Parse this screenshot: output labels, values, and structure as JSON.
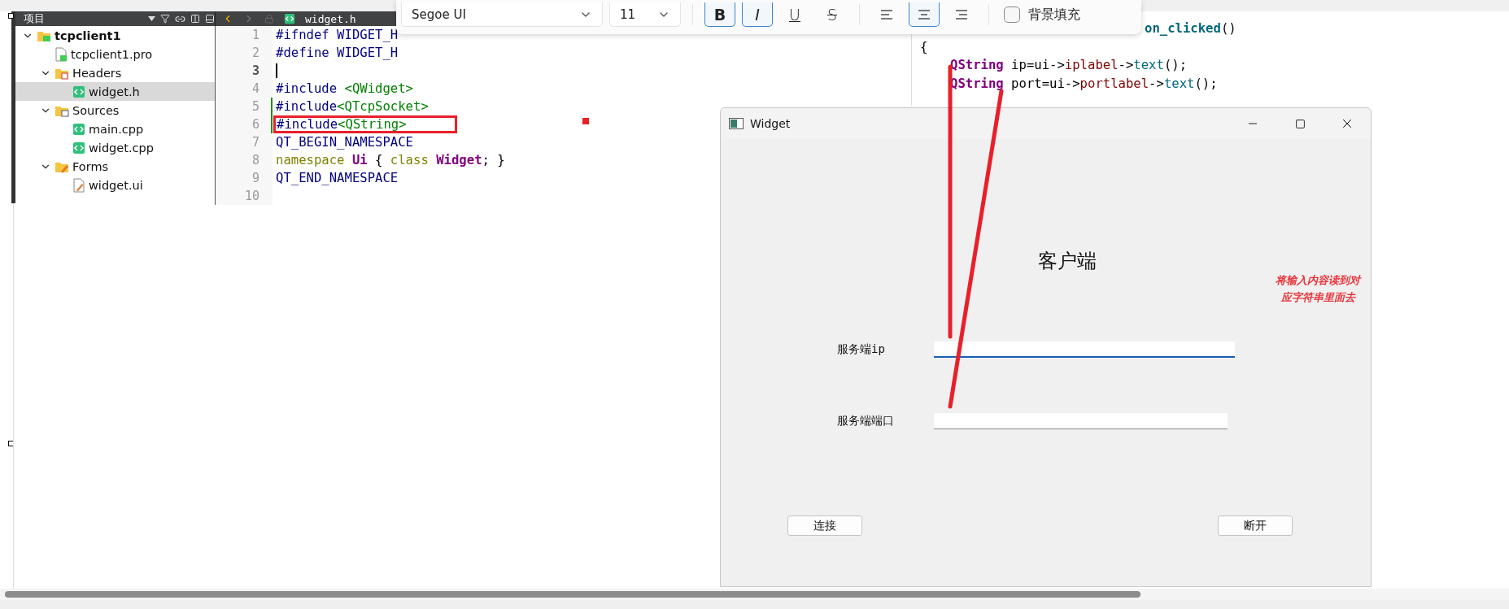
{
  "project_panel": {
    "title": "项目",
    "tree": [
      {
        "label": "tcpclient1",
        "kind": "project",
        "expanded": true,
        "selected": false,
        "children": [
          {
            "label": "tcpclient1.pro",
            "kind": "pro",
            "selected": false
          },
          {
            "label": "Headers",
            "kind": "headers",
            "expanded": true,
            "selected": false,
            "children": [
              {
                "label": "widget.h",
                "kind": "file",
                "selected": true
              }
            ]
          },
          {
            "label": "Sources",
            "kind": "sources",
            "expanded": true,
            "selected": false,
            "children": [
              {
                "label": "main.cpp",
                "kind": "file",
                "selected": false
              },
              {
                "label": "widget.cpp",
                "kind": "file",
                "selected": false
              }
            ]
          },
          {
            "label": "Forms",
            "kind": "forms",
            "expanded": true,
            "selected": false,
            "children": [
              {
                "label": "widget.ui",
                "kind": "ui",
                "selected": false
              }
            ]
          }
        ]
      }
    ]
  },
  "editor": {
    "file_tab": "widget.h",
    "lines": [
      {
        "number": "1",
        "current": false,
        "modified": false,
        "boxed": false,
        "tokens": [
          {
            "text": "#ifndef WIDGET_H",
            "kind": "macro"
          }
        ]
      },
      {
        "number": "2",
        "current": false,
        "modified": false,
        "boxed": false,
        "tokens": [
          {
            "text": "#define WIDGET_H",
            "kind": "macro"
          }
        ]
      },
      {
        "number": "3",
        "current": true,
        "modified": false,
        "boxed": false
      },
      {
        "number": "4",
        "current": false,
        "modified": false,
        "boxed": false,
        "tokens": [
          {
            "text": "#include ",
            "kind": "macro"
          },
          {
            "text": "<QWidget>",
            "kind": "string"
          }
        ]
      },
      {
        "number": "5",
        "current": false,
        "modified": true,
        "boxed": false,
        "tokens": [
          {
            "text": "#include",
            "kind": "macro"
          },
          {
            "text": "<QTcpSocket>",
            "kind": "string"
          }
        ]
      },
      {
        "number": "6",
        "current": false,
        "modified": true,
        "boxed": true,
        "tokens": [
          {
            "text": "#include",
            "kind": "macro"
          },
          {
            "text": "<QString>",
            "kind": "string"
          }
        ]
      },
      {
        "number": "7",
        "current": false,
        "modified": false,
        "boxed": false,
        "tokens": [
          {
            "text": "QT_BEGIN_NAMESPACE",
            "kind": "macro"
          }
        ]
      },
      {
        "number": "8",
        "current": false,
        "modified": false,
        "boxed": false,
        "tokens": [
          {
            "text": "namespace",
            "kind": "keyword"
          },
          {
            "text": " Ui",
            "kind": "type"
          },
          {
            "text": " { ",
            "kind": "plain"
          },
          {
            "text": "class",
            "kind": "keyword"
          },
          {
            "text": " Widget",
            "kind": "type"
          },
          {
            "text": "; }",
            "kind": "plain"
          }
        ]
      },
      {
        "number": "9",
        "current": false,
        "modified": false,
        "boxed": false,
        "tokens": [
          {
            "text": "QT_END_NAMESPACE",
            "kind": "macro"
          }
        ]
      },
      {
        "number": "10",
        "current": false,
        "modified": false,
        "boxed": false
      }
    ]
  },
  "format_toolbar": {
    "font_family": "Segoe UI",
    "font_size": "11",
    "format_buttons": [
      {
        "glyph": "B",
        "kind": "bold",
        "selected": true
      },
      {
        "glyph": "I",
        "kind": "italic",
        "selected": true
      },
      {
        "glyph": "U",
        "kind": "underline",
        "selected": false
      },
      {
        "glyph": "S",
        "kind": "strike",
        "selected": false
      }
    ],
    "align_buttons": [
      {
        "kind": "left",
        "selected": false
      },
      {
        "kind": "center",
        "selected": true
      },
      {
        "kind": "right",
        "selected": false
      }
    ],
    "fill_checkbox": {
      "label": "背景填充",
      "checked": false
    }
  },
  "code_right": {
    "lines": [
      {
        "indent": false,
        "tokens": [
          {
            "text": "on_clicked",
            "kind": "function"
          },
          {
            "text": "()",
            "kind": "plain"
          }
        ]
      },
      {
        "indent": false,
        "tokens": [
          {
            "text": "{",
            "kind": "plain"
          }
        ]
      },
      {
        "indent": true,
        "tokens": [
          {
            "text": "QString",
            "kind": "type"
          },
          {
            "text": " ip=ui->",
            "kind": "plain"
          },
          {
            "text": "iplabel",
            "kind": "member"
          },
          {
            "text": "->",
            "kind": "plain"
          },
          {
            "text": "text",
            "kind": "call"
          },
          {
            "text": "();",
            "kind": "plain"
          }
        ]
      },
      {
        "indent": true,
        "tokens": [
          {
            "text": "QString",
            "kind": "type"
          },
          {
            "text": " port=ui->",
            "kind": "plain"
          },
          {
            "text": "portlabel",
            "kind": "member"
          },
          {
            "text": "->",
            "kind": "plain"
          },
          {
            "text": "text",
            "kind": "call"
          },
          {
            "text": "();",
            "kind": "plain"
          }
        ]
      }
    ]
  },
  "widget_window": {
    "title": "Widget",
    "heading": "客户端",
    "fields": [
      {
        "label": "服务端ip",
        "focused": true
      },
      {
        "label": "服务端端口",
        "focused": false
      }
    ],
    "buttons": [
      "连接",
      "断开"
    ]
  },
  "annotation": {
    "note_lines": [
      "将输入内容读到对",
      "应字符串里面去"
    ]
  }
}
